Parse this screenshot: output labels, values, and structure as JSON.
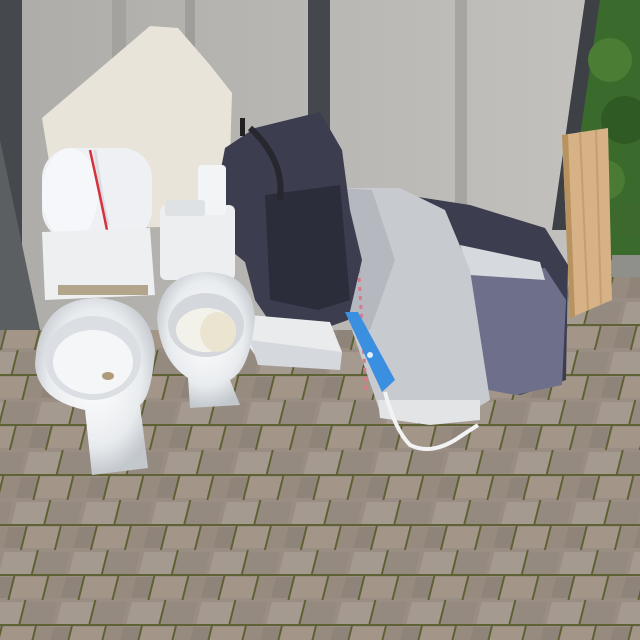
{
  "scene": {
    "description_visible_text": "",
    "colors": {
      "wall": "#b9b7b3",
      "wall_shadow": "#9e9c98",
      "pillar_dark": "#3f4347",
      "pavement": "#9a8e84",
      "pavement_dark": "#7d7168",
      "moss": "#4f5a2e",
      "porcelain": "#eef0f1",
      "porcelain_shadow": "#c9ced3",
      "foam_board": "#e6e2d6",
      "navy_bag": "#3b3c4d",
      "grey_cover": "#c8cbd0",
      "wood": "#d7b48a",
      "hedge": "#3d6a2e",
      "blue_tool": "#3a8fe0",
      "red_strap": "#d8303a"
    },
    "objects": [
      "toilet-left",
      "toilet-right",
      "rolled-foam-mat",
      "foam-board",
      "navy-backpack",
      "grey-folded-cover",
      "purple-bag",
      "wood-panel",
      "blue-tool",
      "white-cable"
    ]
  }
}
